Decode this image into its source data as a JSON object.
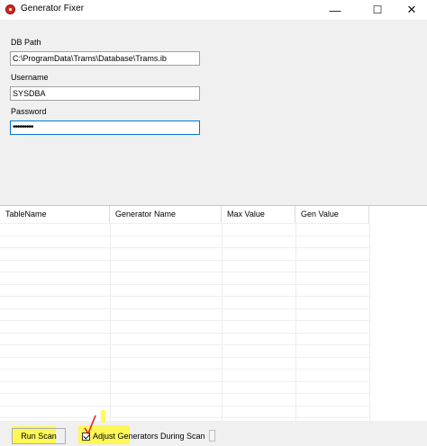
{
  "window": {
    "title": "Generator Fixer"
  },
  "titlebar_buttons": {
    "minimize": "—",
    "maximize": "☐",
    "close": "✕"
  },
  "form": {
    "db_path_label": "DB Path",
    "db_path_value": "C:\\ProgramData\\Trams\\Database\\Trams.ib",
    "username_label": "Username",
    "username_value": "SYSDBA",
    "password_label": "Password",
    "password_value": "•••••••••"
  },
  "grid": {
    "columns": [
      "TableName",
      "Generator Name",
      "Max Value",
      "Gen Value"
    ]
  },
  "bottom": {
    "run_scan_label": "Run Scan",
    "adjust_label": "Adjust Generators During Scan",
    "adjust_checked": true
  },
  "colors": {
    "highlight": "#fff93a",
    "annotation_red": "#e0161e",
    "focus_border": "#0078d7"
  }
}
